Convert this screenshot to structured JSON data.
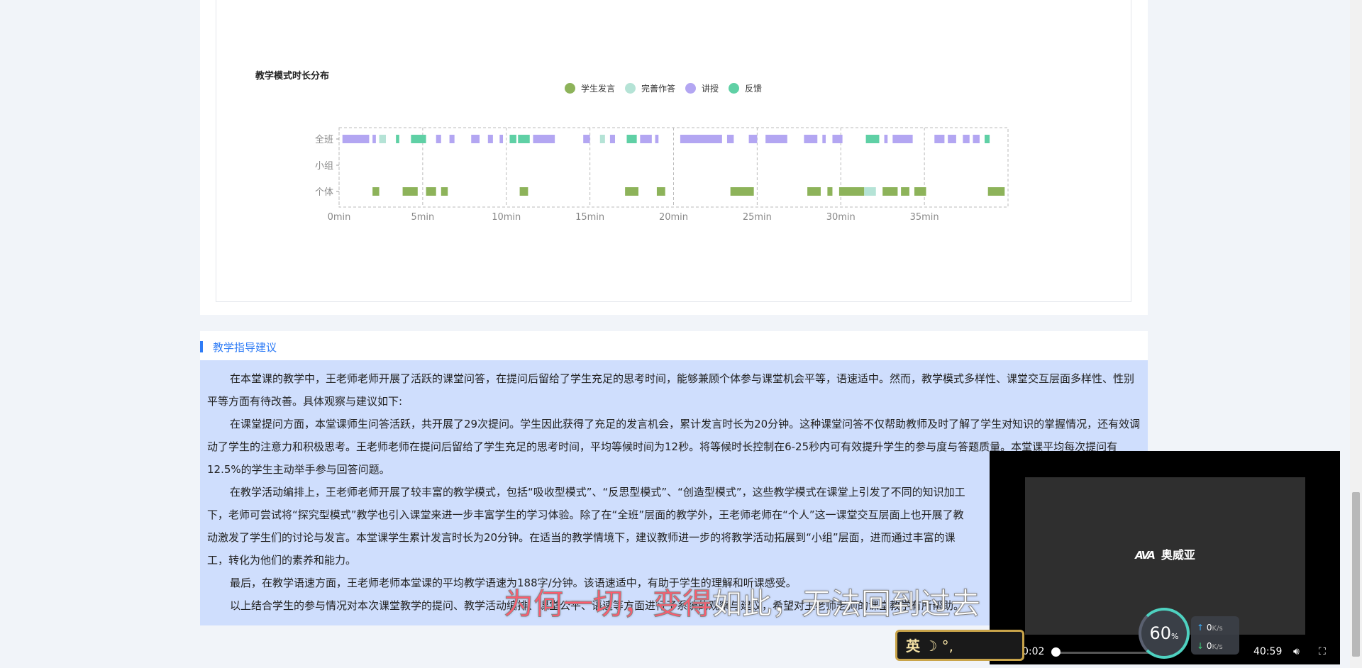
{
  "chart_data": {
    "type": "timeline",
    "title": "教学模式时长分布",
    "legend": [
      {
        "name": "学生发言",
        "color": "#8db35a"
      },
      {
        "name": "完善作答",
        "color": "#b5e3d6"
      },
      {
        "name": "讲授",
        "color": "#b3a6f2"
      },
      {
        "name": "反馈",
        "color": "#5fd0a5"
      }
    ],
    "categories": [
      "全班",
      "小组",
      "个体"
    ],
    "x_ticks": [
      "0min",
      "5min",
      "10min",
      "15min",
      "20min",
      "25min",
      "30min",
      "35min"
    ],
    "x_range": [
      0,
      40
    ],
    "grid": true,
    "segments": [
      {
        "row": "全班",
        "type": "讲授",
        "start": 0.2,
        "end": 1.8
      },
      {
        "row": "全班",
        "type": "讲授",
        "start": 2.0,
        "end": 2.2
      },
      {
        "row": "全班",
        "type": "完善作答",
        "start": 2.4,
        "end": 2.8
      },
      {
        "row": "全班",
        "type": "反馈",
        "start": 3.4,
        "end": 3.6
      },
      {
        "row": "全班",
        "type": "反馈",
        "start": 4.3,
        "end": 5.2
      },
      {
        "row": "全班",
        "type": "讲授",
        "start": 5.8,
        "end": 6.1
      },
      {
        "row": "全班",
        "type": "讲授",
        "start": 6.6,
        "end": 6.9
      },
      {
        "row": "全班",
        "type": "讲授",
        "start": 7.9,
        "end": 8.4
      },
      {
        "row": "全班",
        "type": "讲授",
        "start": 8.9,
        "end": 9.2
      },
      {
        "row": "全班",
        "type": "讲授",
        "start": 9.6,
        "end": 9.8
      },
      {
        "row": "全班",
        "type": "反馈",
        "start": 10.2,
        "end": 10.6
      },
      {
        "row": "全班",
        "type": "反馈",
        "start": 10.7,
        "end": 11.4
      },
      {
        "row": "全班",
        "type": "讲授",
        "start": 11.6,
        "end": 12.9
      },
      {
        "row": "全班",
        "type": "讲授",
        "start": 14.6,
        "end": 15.0
      },
      {
        "row": "全班",
        "type": "完善作答",
        "start": 15.6,
        "end": 15.9
      },
      {
        "row": "全班",
        "type": "讲授",
        "start": 16.2,
        "end": 16.5
      },
      {
        "row": "全班",
        "type": "反馈",
        "start": 17.2,
        "end": 17.8
      },
      {
        "row": "全班",
        "type": "讲授",
        "start": 18.0,
        "end": 18.7
      },
      {
        "row": "全班",
        "type": "讲授",
        "start": 18.9,
        "end": 19.1
      },
      {
        "row": "全班",
        "type": "讲授",
        "start": 20.4,
        "end": 22.9
      },
      {
        "row": "全班",
        "type": "讲授",
        "start": 23.2,
        "end": 23.6
      },
      {
        "row": "全班",
        "type": "讲授",
        "start": 24.5,
        "end": 25.0
      },
      {
        "row": "全班",
        "type": "讲授",
        "start": 25.5,
        "end": 26.8
      },
      {
        "row": "全班",
        "type": "讲授",
        "start": 27.8,
        "end": 28.6
      },
      {
        "row": "全班",
        "type": "讲授",
        "start": 28.9,
        "end": 29.1
      },
      {
        "row": "全班",
        "type": "讲授",
        "start": 29.5,
        "end": 30.1
      },
      {
        "row": "全班",
        "type": "反馈",
        "start": 31.5,
        "end": 32.3
      },
      {
        "row": "全班",
        "type": "讲授",
        "start": 32.6,
        "end": 32.8
      },
      {
        "row": "全班",
        "type": "讲授",
        "start": 33.1,
        "end": 34.3
      },
      {
        "row": "全班",
        "type": "讲授",
        "start": 35.6,
        "end": 36.2
      },
      {
        "row": "全班",
        "type": "讲授",
        "start": 36.4,
        "end": 36.9
      },
      {
        "row": "全班",
        "type": "讲授",
        "start": 37.3,
        "end": 37.7
      },
      {
        "row": "全班",
        "type": "讲授",
        "start": 37.9,
        "end": 38.3
      },
      {
        "row": "全班",
        "type": "反馈",
        "start": 38.6,
        "end": 38.9
      },
      {
        "row": "个体",
        "type": "学生发言",
        "start": 2.0,
        "end": 2.4
      },
      {
        "row": "个体",
        "type": "学生发言",
        "start": 3.8,
        "end": 4.7
      },
      {
        "row": "个体",
        "type": "学生发言",
        "start": 5.2,
        "end": 5.8
      },
      {
        "row": "个体",
        "type": "学生发言",
        "start": 6.1,
        "end": 6.5
      },
      {
        "row": "个体",
        "type": "学生发言",
        "start": 10.8,
        "end": 11.3
      },
      {
        "row": "个体",
        "type": "学生发言",
        "start": 17.1,
        "end": 17.9
      },
      {
        "row": "个体",
        "type": "学生发言",
        "start": 19.0,
        "end": 19.5
      },
      {
        "row": "个体",
        "type": "学生发言",
        "start": 23.4,
        "end": 24.8
      },
      {
        "row": "个体",
        "type": "学生发言",
        "start": 28.0,
        "end": 28.8
      },
      {
        "row": "个体",
        "type": "学生发言",
        "start": 29.2,
        "end": 29.5
      },
      {
        "row": "个体",
        "type": "学生发言",
        "start": 29.9,
        "end": 31.4
      },
      {
        "row": "个体",
        "type": "完善作答",
        "start": 31.4,
        "end": 32.1
      },
      {
        "row": "个体",
        "type": "学生发言",
        "start": 32.5,
        "end": 33.4
      },
      {
        "row": "个体",
        "type": "学生发言",
        "start": 33.6,
        "end": 34.1
      },
      {
        "row": "个体",
        "type": "学生发言",
        "start": 34.4,
        "end": 35.1
      },
      {
        "row": "个体",
        "type": "学生发言",
        "start": 38.8,
        "end": 39.8
      }
    ]
  },
  "advice": {
    "title": "教学指导建议",
    "paragraphs": [
      "在本堂课的教学中，王老师老师开展了活跃的课堂问答，在提问后留给了学生充足的思考时间，能够兼顾个体参与课堂机会平等，语速适中。然而，教学模式多样性、课堂交互层面多样性、性别平等方面有待改善。具体观察与建议如下:",
      "在课堂提问方面，本堂课师生问答活跃，共开展了29次提问。学生因此获得了充足的发言机会，累计发言时长为20分钟。这种课堂问答不仅帮助教师及时了解了学生对知识的掌握情况，还有效调动了学生的注意力和积极思考。王老师老师在提问后留给了学生充足的思考时间，平均等候时间为12秒。将等候时长控制在6-25秒内可有效提升学生的参与度与答题质量。本堂课平均每次提问有12.5%的学生主动举手参与回答问题。",
      "在教学活动编排上，王老师老师开展了较丰富的教学模式，包括“吸收型模式”、“反思型模式”、“创造型模式”，这些教学模式在课堂上引发了不同的知识加工",
      "下，老师可尝试将“探究型模式”教学也引入课堂来进一步丰富学生的学习体验。除了在“全班”层面的教学外，王老师老师在“个人”这一课堂交互层面上也开展了教",
      "动激发了学生们的讨论与发言。本堂课学生累计发言时长为20分钟。在适当的教学情境下，建议教师进一步的将教学活动拓展到“小组”层面，进而通过丰富的课",
      "工，转化为他们的素养和能力。",
      "最后，在教学语速方面，王老师老师本堂课的平均教学语速为188字/分钟。该语速适中，有助于学生的理解和听课感受。",
      "以上结合学生的参与情况对本次课堂教学的提问、教学活动编排、课堂公平、语速等方面进行了系统的观察与建议，希望对王老师老师的课堂教学有所帮助。"
    ]
  },
  "video": {
    "brand": "奥威亚",
    "logo": "AVA",
    "current_time": "0:02",
    "total_time": "40:59",
    "progress": 0.0008
  },
  "netspeed": {
    "percent": "60",
    "percent_unit": "%",
    "up": "0",
    "down": "0",
    "unit": "K/s"
  },
  "ime": {
    "lang": "英",
    "symbols": "☽ °,"
  },
  "subtitle": {
    "part1": "为何一切，",
    "part2": "变得",
    "part3": "如此，无法回到过去"
  }
}
